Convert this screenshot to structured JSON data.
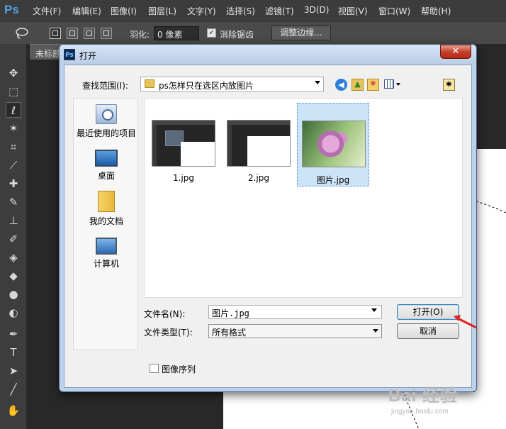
{
  "ps": {
    "logo": "Ps",
    "menu": [
      "文件(F)",
      "编辑(E)",
      "图像(I)",
      "图层(L)",
      "文字(Y)",
      "选择(S)",
      "滤镜(T)",
      "3D(D)",
      "视图(V)",
      "窗口(W)",
      "帮助(H)"
    ],
    "options": {
      "feather_label": "羽化:",
      "feather_value": "0 像素",
      "antialias_label": "消除锯齿",
      "refine_edge_label": "调整边缘..."
    },
    "doc_tab": "未标题"
  },
  "dialog": {
    "title": "打开",
    "lookin_label": "查找范围(I):",
    "lookin_value": "ps怎样只在选区内放图片",
    "places": [
      {
        "label": "最近使用的项目",
        "icon": "recent-items-icon"
      },
      {
        "label": "桌面",
        "icon": "desktop-icon"
      },
      {
        "label": "我的文档",
        "icon": "my-documents-icon"
      },
      {
        "label": "计算机",
        "icon": "computer-icon"
      }
    ],
    "files": [
      {
        "name": "1.jpg"
      },
      {
        "name": "2.jpg"
      },
      {
        "name": "图片.jpg",
        "selected": true
      }
    ],
    "filename_label": "文件名(N):",
    "filename_value": "图片.jpg",
    "filetype_label": "文件类型(T):",
    "filetype_value": "所有格式",
    "open_label": "打开(O)",
    "cancel_label": "取消",
    "image_sequence_label": "图像序列"
  },
  "watermark": {
    "main": "Bai 经验",
    "sub": "jingyan.baidu.com"
  },
  "colors": {
    "ps_blue": "#4fa3e6",
    "selection": "#cce4f7",
    "arrow_red": "#e02020"
  }
}
